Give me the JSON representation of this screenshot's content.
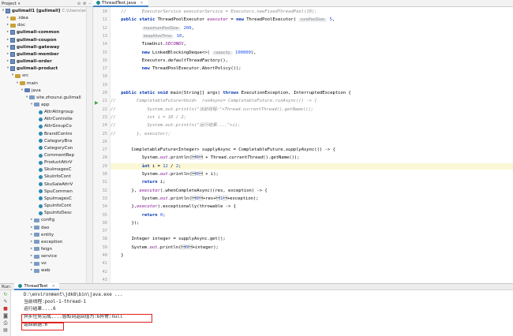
{
  "header": {
    "project_label": "Project",
    "tab_label": "ThreadTest.java"
  },
  "tree": [
    {
      "text": "gulimall1 [gulimall]",
      "extra": "C:\\Users\\eric\\",
      "indent": 0,
      "tw": "▾",
      "icon": "mod",
      "bold": true
    },
    {
      "text": ".idea",
      "indent": 1,
      "tw": "▸",
      "icon": "fold"
    },
    {
      "text": "doc",
      "indent": 1,
      "tw": "▸",
      "icon": "fold"
    },
    {
      "text": "gulimall-common",
      "indent": 1,
      "tw": "▸",
      "icon": "mod",
      "bold": true
    },
    {
      "text": "gulimall-coupon",
      "indent": 1,
      "tw": "▸",
      "icon": "mod",
      "bold": true
    },
    {
      "text": "gulimall-gateway",
      "indent": 1,
      "tw": "▸",
      "icon": "mod",
      "bold": true
    },
    {
      "text": "gulimall-member",
      "indent": 1,
      "tw": "▸",
      "icon": "mod",
      "bold": true
    },
    {
      "text": "gulimall-order",
      "indent": 1,
      "tw": "▸",
      "icon": "mod",
      "bold": true
    },
    {
      "text": "gulimall-product",
      "indent": 1,
      "tw": "▾",
      "icon": "mod",
      "bold": true
    },
    {
      "text": "src",
      "indent": 2,
      "tw": "▾",
      "icon": "fold"
    },
    {
      "text": "main",
      "indent": 3,
      "tw": "▾",
      "icon": "fold"
    },
    {
      "text": "java",
      "indent": 4,
      "tw": "▾",
      "icon": "src"
    },
    {
      "text": "site.zhourui.gulimall",
      "indent": 5,
      "tw": "▾",
      "icon": "blue"
    },
    {
      "text": "app",
      "indent": 6,
      "tw": "▾",
      "icon": "blue"
    },
    {
      "text": "AttrAttrgroup",
      "indent": 7,
      "tw": "",
      "icon": "cls"
    },
    {
      "text": "AttrControlle",
      "indent": 7,
      "tw": "",
      "icon": "cls"
    },
    {
      "text": "AttrGroupCo",
      "indent": 7,
      "tw": "",
      "icon": "cls"
    },
    {
      "text": "BrandContro",
      "indent": 7,
      "tw": "",
      "icon": "cls"
    },
    {
      "text": "CategoryBra",
      "indent": 7,
      "tw": "",
      "icon": "cls"
    },
    {
      "text": "CategoryCon",
      "indent": 7,
      "tw": "",
      "icon": "cls"
    },
    {
      "text": "CommentRep",
      "indent": 7,
      "tw": "",
      "icon": "cls"
    },
    {
      "text": "ProductAttrV",
      "indent": 7,
      "tw": "",
      "icon": "cls"
    },
    {
      "text": "SkuImagesC",
      "indent": 7,
      "tw": "",
      "icon": "cls"
    },
    {
      "text": "SkuInfoCont",
      "indent": 7,
      "tw": "",
      "icon": "cls"
    },
    {
      "text": "SkuSaleAttrV",
      "indent": 7,
      "tw": "",
      "icon": "cls"
    },
    {
      "text": "SpuCommen",
      "indent": 7,
      "tw": "",
      "icon": "cls"
    },
    {
      "text": "SpuImagesC",
      "indent": 7,
      "tw": "",
      "icon": "cls"
    },
    {
      "text": "SpuInfoCont",
      "indent": 7,
      "tw": "",
      "icon": "cls"
    },
    {
      "text": "SpuInfoDesc",
      "indent": 7,
      "tw": "",
      "icon": "cls"
    },
    {
      "text": "config",
      "indent": 6,
      "tw": "▸",
      "icon": "blue"
    },
    {
      "text": "dao",
      "indent": 6,
      "tw": "▸",
      "icon": "blue"
    },
    {
      "text": "entity",
      "indent": 6,
      "tw": "▸",
      "icon": "blue"
    },
    {
      "text": "exception",
      "indent": 6,
      "tw": "▸",
      "icon": "blue"
    },
    {
      "text": "feign",
      "indent": 6,
      "tw": "▸",
      "icon": "blue"
    },
    {
      "text": "service",
      "indent": 6,
      "tw": "▸",
      "icon": "blue"
    },
    {
      "text": "vo",
      "indent": 6,
      "tw": "▸",
      "icon": "blue"
    },
    {
      "text": "web",
      "indent": 6,
      "tw": "▸",
      "icon": "blue"
    }
  ],
  "gutter_lines": [
    "10",
    "11",
    "12",
    "13",
    "14",
    "15",
    "16",
    "17",
    "18",
    "19",
    "20",
    "21",
    "22",
    "23",
    "24",
    "25",
    "26",
    "27",
    "28",
    "29",
    "30",
    "31",
    "32",
    "33",
    "34",
    "35",
    "36",
    "37",
    "38",
    "39",
    "40",
    "41",
    "42",
    "43"
  ],
  "code": [
    {
      "t": "c",
      "v": "    //      ExecutorService executorService = Executors.newFixedThreadPool(10);"
    },
    {
      "t": "n",
      "v": "    public static ThreadPoolExecutor executor = new ThreadPoolExecutor( corePoolSize: 5,"
    },
    {
      "t": "n",
      "v": "            maximumPoolSize: 200,"
    },
    {
      "t": "n",
      "v": "            keepAliveTime: 10,"
    },
    {
      "t": "n",
      "v": "            TimeUnit.SECONDS,"
    },
    {
      "t": "n",
      "v": "            new LinkedBlockingDeque<>( capacity: 100000),"
    },
    {
      "t": "n",
      "v": "            Executors.defaultThreadFactory(),"
    },
    {
      "t": "n",
      "v": "            new ThreadPoolExecutor.AbortPolicy());"
    },
    {
      "t": "n",
      "v": ""
    },
    {
      "t": "n",
      "v": ""
    },
    {
      "t": "n",
      "v": "    public static void main(String[] args) throws ExecutionException, InterruptedException {"
    },
    {
      "t": "c",
      "v": "//        CompletableFuture<Void>  runAsync= CompletableFuture.runAsync(() -> {"
    },
    {
      "t": "c",
      "v": "//            System.out.println(\"当前线程:\"+Thread.currentThread().getName());"
    },
    {
      "t": "c",
      "v": "//            int i = 10 / 2;"
    },
    {
      "t": "c",
      "v": "//            System.out.println(\"运行结果....\"+i);"
    },
    {
      "t": "c",
      "v": "//        }, executor);"
    },
    {
      "t": "n",
      "v": ""
    },
    {
      "t": "n",
      "v": "        CompletableFuture<Integer> supplyAsync = CompletableFuture.supplyAsync(() -> {"
    },
    {
      "t": "n",
      "v": "            System.out.println(\"当前线程:\" + Thread.currentThread().getName());"
    },
    {
      "t": "n",
      "v": "            int i = 12 / 2;"
    },
    {
      "t": "n",
      "v": "            System.out.println(\"运行结果....\" + i);"
    },
    {
      "t": "n",
      "v": "            return i;"
    },
    {
      "t": "n",
      "v": "        }, executor).whenCompleteAsync((res, exception) -> {"
    },
    {
      "t": "n",
      "v": "            System.out.println(\"异步任务完成....感知到返回值为:\"+res+\"异常:\"+exception);"
    },
    {
      "t": "n",
      "v": "        },executor).exceptionally(throwable -> {"
    },
    {
      "t": "n",
      "v": "            return 0;"
    },
    {
      "t": "n",
      "v": "        });"
    },
    {
      "t": "n",
      "v": ""
    },
    {
      "t": "n",
      "v": "        Integer integer = supplyAsync.get();"
    },
    {
      "t": "n",
      "v": "        System.out.println(\"返回数据:\"+integer);"
    },
    {
      "t": "n",
      "v": "    }"
    },
    {
      "t": "n",
      "v": ""
    },
    {
      "t": "n",
      "v": ""
    },
    {
      "t": "n",
      "v": ""
    }
  ],
  "run": {
    "label": "Run:",
    "tab": "ThreadTest",
    "output": [
      "D:\\environment\\jdk8\\bin\\java.exe ...",
      "当前线程:pool-1-thread-1",
      "运行结果....6",
      "异步任务完成....感知到返回值为:6异常:null",
      "返回数据:6"
    ]
  }
}
